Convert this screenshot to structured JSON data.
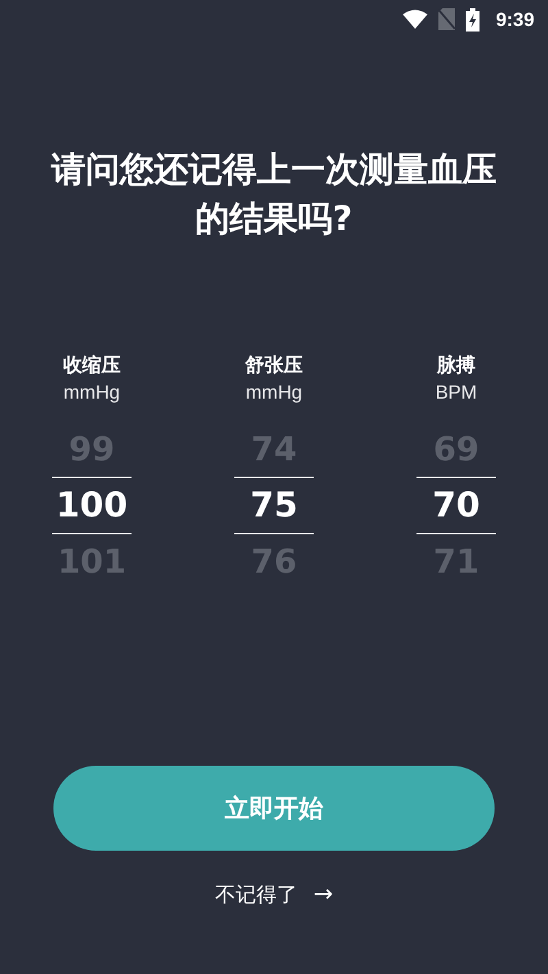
{
  "status_bar": {
    "time": "9:39"
  },
  "title": "请问您还记得上一次测量血压的结果吗?",
  "pickers": [
    {
      "label": "收缩压",
      "unit": "mmHg",
      "values": [
        {
          "text": "99",
          "selected": false
        },
        {
          "text": "100",
          "selected": true
        },
        {
          "text": "101",
          "selected": false
        }
      ]
    },
    {
      "label": "舒张压",
      "unit": "mmHg",
      "values": [
        {
          "text": "74",
          "selected": false
        },
        {
          "text": "75",
          "selected": true
        },
        {
          "text": "76",
          "selected": false
        }
      ]
    },
    {
      "label": "脉搏",
      "unit": "BPM",
      "values": [
        {
          "text": "69",
          "selected": false
        },
        {
          "text": "70",
          "selected": true
        },
        {
          "text": "71",
          "selected": false
        }
      ]
    }
  ],
  "primary_button": "立即开始",
  "skip_link": {
    "label": "不记得了",
    "arrow": "→"
  }
}
